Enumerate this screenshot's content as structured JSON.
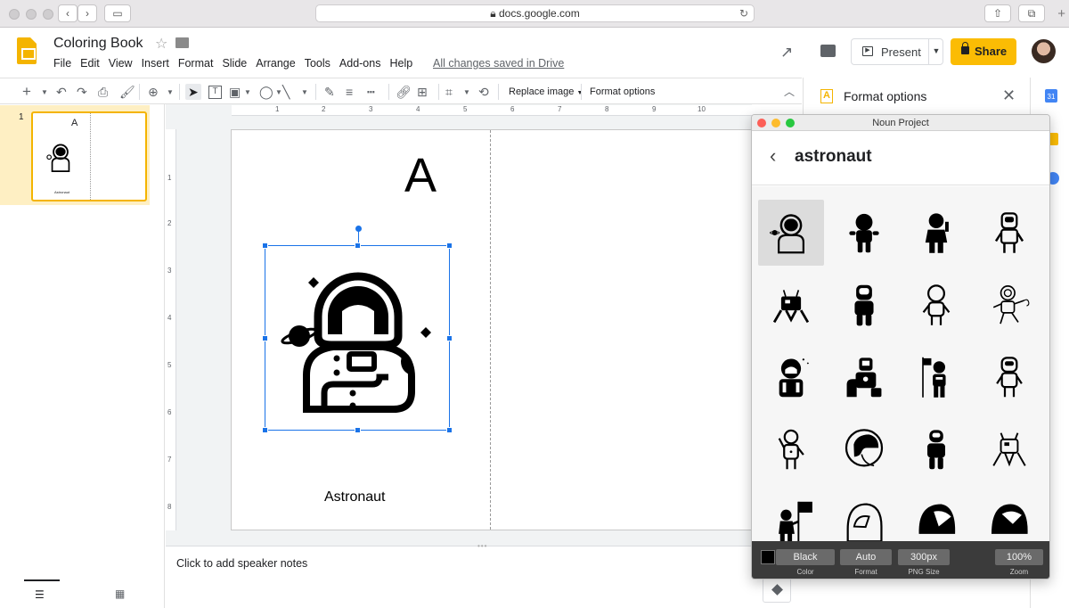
{
  "browser": {
    "url": "docs.google.com"
  },
  "app": {
    "doc_title": "Coloring Book",
    "menu": [
      "File",
      "Edit",
      "View",
      "Insert",
      "Format",
      "Slide",
      "Arrange",
      "Tools",
      "Add-ons",
      "Help"
    ],
    "save_status": "All changes saved in Drive",
    "present_label": "Present",
    "share_label": "Share"
  },
  "toolbar": {
    "replace_image": "Replace image",
    "format_options": "Format options"
  },
  "format_panel": {
    "title": "Format options",
    "calendar_day": "31"
  },
  "filmstrip": {
    "slide_number": "1",
    "thumb_letter": "A",
    "thumb_caption": "Astronaut"
  },
  "slide": {
    "letter": "A",
    "caption": "Astronaut"
  },
  "rulers": {
    "horizontal": [
      "1",
      "2",
      "3",
      "4",
      "5",
      "6",
      "7",
      "8",
      "9",
      "10"
    ],
    "vertical": [
      "1",
      "2",
      "3",
      "4",
      "5",
      "6",
      "7",
      "8"
    ]
  },
  "notes": {
    "placeholder": "Click to add speaker notes"
  },
  "noun_project": {
    "window_title": "Noun Project",
    "query": "astronaut",
    "footer": {
      "color_value": "Black",
      "color_label": "Color",
      "format_value": "Auto",
      "format_label": "Format",
      "size_value": "300px",
      "size_label": "PNG Size",
      "zoom_value": "100%",
      "zoom_label": "Zoom"
    },
    "selected_swatch": "#000000"
  },
  "colors": {
    "brand_yellow": "#f4b400",
    "share_button": "#fbbc04",
    "selection_blue": "#1a73e8"
  }
}
